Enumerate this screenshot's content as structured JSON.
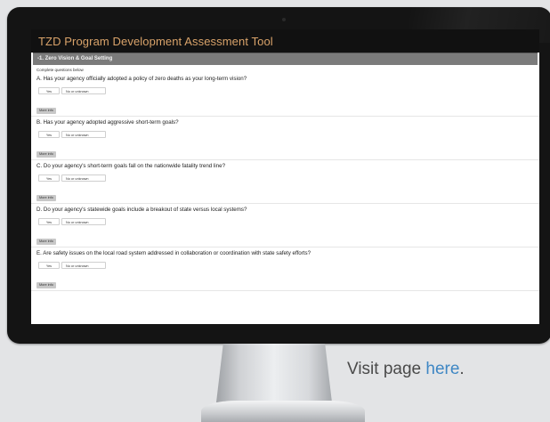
{
  "app": {
    "title": "TZD Program Development Assessment Tool"
  },
  "section": {
    "label": "-1. Zero Vision & Goal Setting"
  },
  "instructions": "Complete questions below",
  "answer_labels": {
    "yes": "Yes",
    "no": "No or unknown",
    "more_info": "More info"
  },
  "questions": [
    {
      "text": "A. Has your agency officially adopted a policy of zero deaths as your long-term vision?"
    },
    {
      "text": "B. Has your agency adopted aggressive short-term goals?"
    },
    {
      "text": "C. Do your agency's short-term goals fall on the nationwide fatality trend line?"
    },
    {
      "text": "D. Do your agency's statewide goals include a breakout of state versus local systems?"
    },
    {
      "text": "E. Are safety issues on the local road system addressed in collaboration or coordination with state safety efforts?"
    }
  ],
  "caption": {
    "prefix": "Visit page ",
    "link": "here",
    "suffix": "."
  },
  "colors": {
    "title": "#d9a36a",
    "header_bg": "#111111",
    "section_bar": "#7b7b7b",
    "link": "#3f87c4"
  }
}
